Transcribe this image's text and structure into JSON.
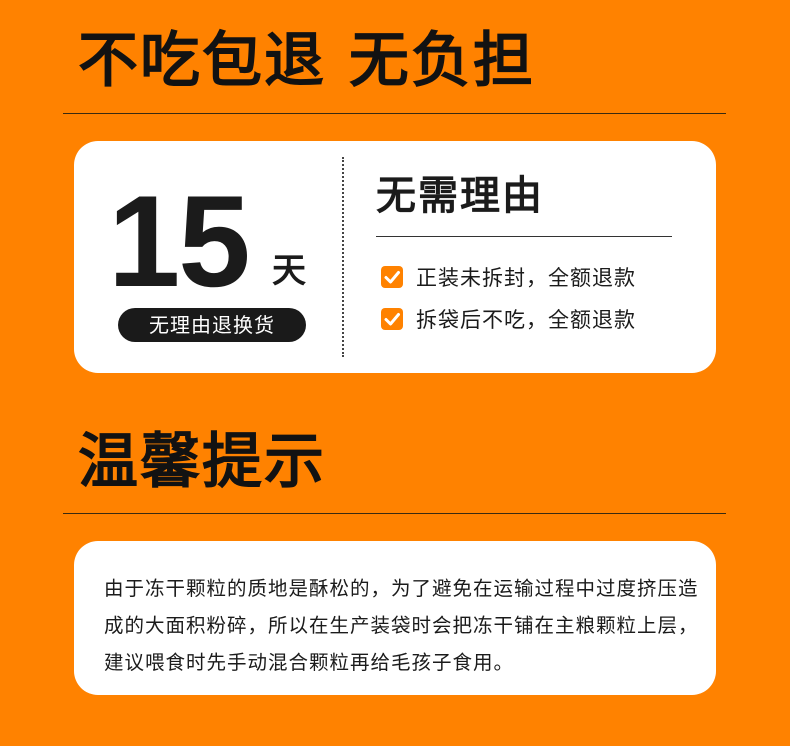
{
  "section1": {
    "title": "不吃包退 无负担"
  },
  "guarantee": {
    "days": "15",
    "unit": "天",
    "badge": "无理由退换货",
    "reason_title": "无需理由",
    "items": [
      {
        "label": "正装未拆封，全额退款",
        "icon": "checkbox-checked-icon"
      },
      {
        "label": "拆袋后不吃，全额退款",
        "icon": "checkbox-checked-icon"
      }
    ]
  },
  "section2": {
    "title": "温馨提示"
  },
  "tips": {
    "text": "由于冻干颗粒的质地是酥松的，为了避免在运输过程中过度挤压造成的大面积粉碎，所以在生产装袋时会把冻干铺在主粮颗粒上层，建议喂食时先手动混合颗粒再给毛孩子食用。"
  },
  "colors": {
    "background": "#ff8200",
    "card": "#ffffff",
    "text": "#1b1b1b",
    "check": "#ff8200"
  }
}
